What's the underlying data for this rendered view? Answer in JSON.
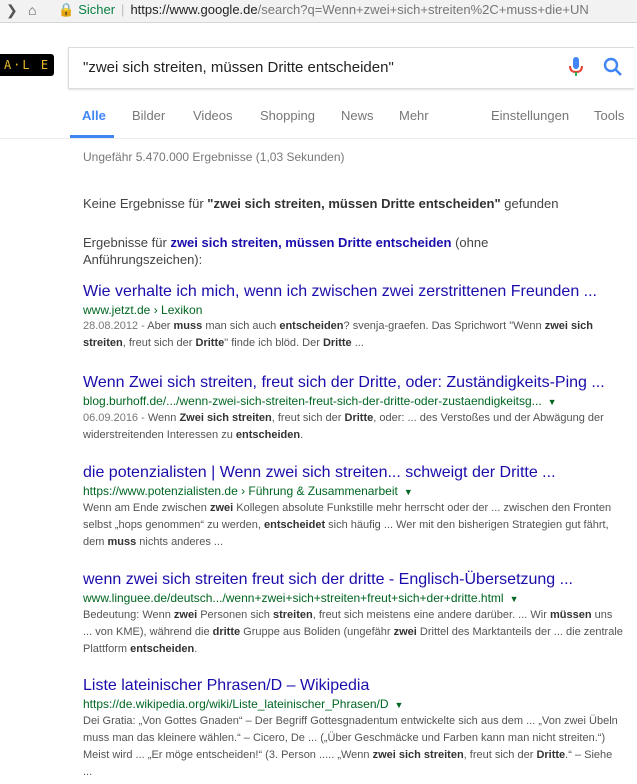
{
  "browser": {
    "secure_label": "Sicher",
    "url_host": "https://www.google.de",
    "url_rest": "/search?q=Wenn+zwei+sich+streiten%2C+muss+die+UN"
  },
  "logo_text": "A·L E",
  "search": {
    "query": "\"zwei sich streiten, müssen Dritte entscheiden\""
  },
  "tabs": [
    {
      "label": "Alle"
    },
    {
      "label": "Bilder"
    },
    {
      "label": "Videos"
    },
    {
      "label": "Shopping"
    },
    {
      "label": "News"
    },
    {
      "label": "Mehr"
    },
    {
      "label": "Einstellungen"
    },
    {
      "label": "Tools"
    }
  ],
  "stats": "Ungefähr 5.470.000 Ergebnisse (1,03 Sekunden)",
  "no_results": {
    "prefix": "Keine Ergebnisse für ",
    "query": "\"zwei sich streiten, müssen Dritte entscheiden\"",
    "suffix": " gefunden"
  },
  "results_for": {
    "prefix": "Ergebnisse für ",
    "query": "zwei sich streiten, müssen Dritte entscheiden",
    "suffix": " (ohne Anführungszeichen):"
  },
  "results": [
    {
      "title": "Wie verhalte ich mich, wenn ich zwischen zwei zerstrittenen Freunden ...",
      "url": "www.jetzt.de › Lexikon",
      "snippet_html": "<span class=\"r-date\">28.08.2012 - </span>Aber <b>muss</b> man sich auch <b>entscheiden</b>? svenja-graefen. Das Sprichwort \"Wenn <b>zwei sich streiten</b>, freut sich der <b>Dritte</b>\" finde ich blöd. Der <b>Dritte</b> ..."
    },
    {
      "title": "Wenn Zwei sich streiten, freut sich der Dritte, oder: Zuständigkeits-Ping ...",
      "url": "blog.burhoff.de/.../wenn-zwei-sich-streiten-freut-sich-der-dritte-oder-zustaendigkeitsg...",
      "snippet_html": "<span class=\"r-date\">06.09.2016 - </span>Wenn <b>Zwei sich streiten</b>, freut sich der <b>Dritte</b>, oder: ... des Verstoßes und der Abwägung der widerstreitenden Interessen zu <b>entscheiden</b>."
    },
    {
      "title": "die potenzialisten | Wenn zwei sich streiten... schweigt der Dritte ...",
      "url": "https://www.potenzialisten.de › Führung & Zusammenarbeit",
      "snippet_html": "Wenn am Ende zwischen <b>zwei</b> Kollegen absolute Funkstille mehr herrscht oder der ... zwischen den Fronten selbst „hops genommen“ zu werden, <b>entscheidet</b> sich häufig ... Wer mit den bisherigen Strategien gut fährt, dem <b>muss</b> nichts anderes ..."
    },
    {
      "title": "wenn zwei sich streiten freut sich der dritte - Englisch-Übersetzung ...",
      "url": "www.linguee.de/deutsch.../wenn+zwei+sich+streiten+freut+sich+der+dritte.html",
      "snippet_html": "Bedeutung: Wenn <b>zwei</b> Personen sich <b>streiten</b>, freut sich meistens eine andere darüber. ... Wir <b>müssen</b> uns ... von KME), während die <b>dritte</b> Gruppe aus Boliden (ungefähr <b>zwei</b> Drittel des Marktanteils der ... die zentrale Plattform <b>entscheiden</b>."
    },
    {
      "title": "Liste lateinischer Phrasen/D – Wikipedia",
      "url": "https://de.wikipedia.org/wiki/Liste_lateinischer_Phrasen/D",
      "snippet_html": "Dei Gratia: „Von Gottes Gnaden“ – Der Begriff Gottesgnadentum entwickelte sich aus dem ... „Von zwei Übeln muss man das kleinere wählen.“ – Cicero, De ... („Über Geschmäcke und Farben kann man nicht streiten.“) Meist wird ... „Er möge entscheiden!“ (3. Person ..... „Wenn <b>zwei sich streiten</b>, freut sich der <b>Dritte</b>.“ – Siehe ..."
    }
  ]
}
